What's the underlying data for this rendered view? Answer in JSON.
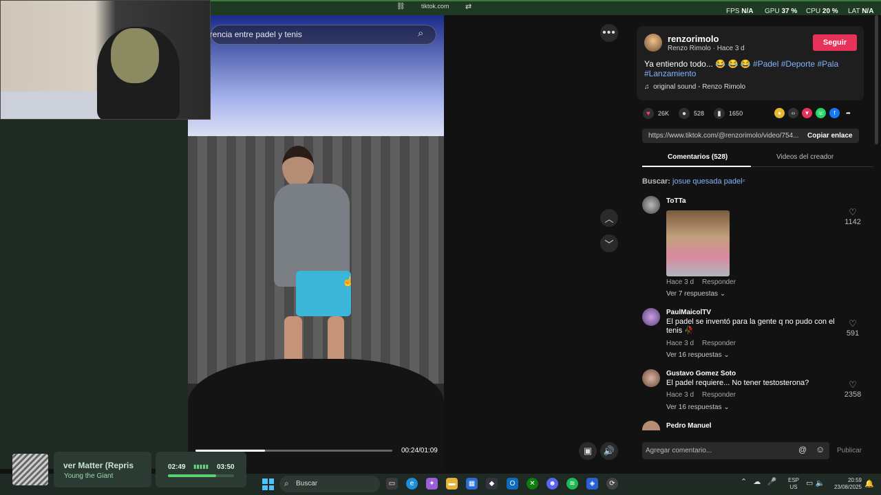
{
  "browser": {
    "url": "tiktok.com",
    "fps": {
      "label": "FPS",
      "value": "N/A"
    },
    "gpu": {
      "label": "GPU",
      "value": "37 %"
    },
    "cpu": {
      "label": "CPU",
      "value": "20 %"
    },
    "lat": {
      "label": "LAT",
      "value": "N/A"
    }
  },
  "video": {
    "search_text": "erencia entre padel y tenis",
    "time": "00:24/01:09",
    "progress": 0.353
  },
  "post": {
    "username": "renzorimolo",
    "subline": "Renzo Rimolo · Hace 3 d",
    "follow_label": "Seguir",
    "caption_text": "Ya entiendo todo... 😂 😂 😂 ",
    "tags": [
      "#Padel",
      "#Deporte",
      "#Pala",
      "#Lanzamiento"
    ],
    "sound": "original sound - Renzo Rimolo",
    "likes": "26K",
    "comments": "528",
    "saves": "1650",
    "url": "https://www.tiktok.com/@renzorimolo/video/754...",
    "copy_label": "Copiar enlace"
  },
  "tabs": {
    "comments": "Comentarios (528)",
    "videos": "Videos del creador"
  },
  "search_suggestion": {
    "label": "Buscar:",
    "query": "josue quesada padel"
  },
  "comments": [
    {
      "name": "ToTTa",
      "text": "",
      "time": "Hace 3 d",
      "reply": "Responder",
      "replies": "Ver 7 respuestas",
      "likes": "1142"
    },
    {
      "name": "PaulMaicolTV",
      "text": "El padel se inventó para la gente q no pudo con el tenis 🥀",
      "time": "Hace 3 d",
      "reply": "Responder",
      "replies": "Ver 16 respuestas",
      "likes": "591"
    },
    {
      "name": "Gustavo Gomez Soto",
      "text": "El padel requiere... No tener testosterona?",
      "time": "Hace 3 d",
      "reply": "Responder",
      "replies": "Ver 16 respuestas",
      "likes": "2358"
    },
    {
      "name": "Pedro Manuel"
    }
  ],
  "comment_input": {
    "placeholder": "Agregar comentario...",
    "publish": "Publicar"
  },
  "music_widget": {
    "title": "ver Matter (Repris",
    "artist": "Young the Giant"
  },
  "timer_widget": {
    "elapsed": "02:49",
    "total": "03:50",
    "progress": 0.73
  },
  "taskbar": {
    "search_placeholder": "Buscar",
    "lang_top": "ESP",
    "lang_bottom": "US",
    "time": "20:59",
    "date": "23/08/2025"
  },
  "colors": {
    "accent": "#e8325a",
    "hashtag": "#7fb6ff",
    "progress": "#59d36e"
  }
}
